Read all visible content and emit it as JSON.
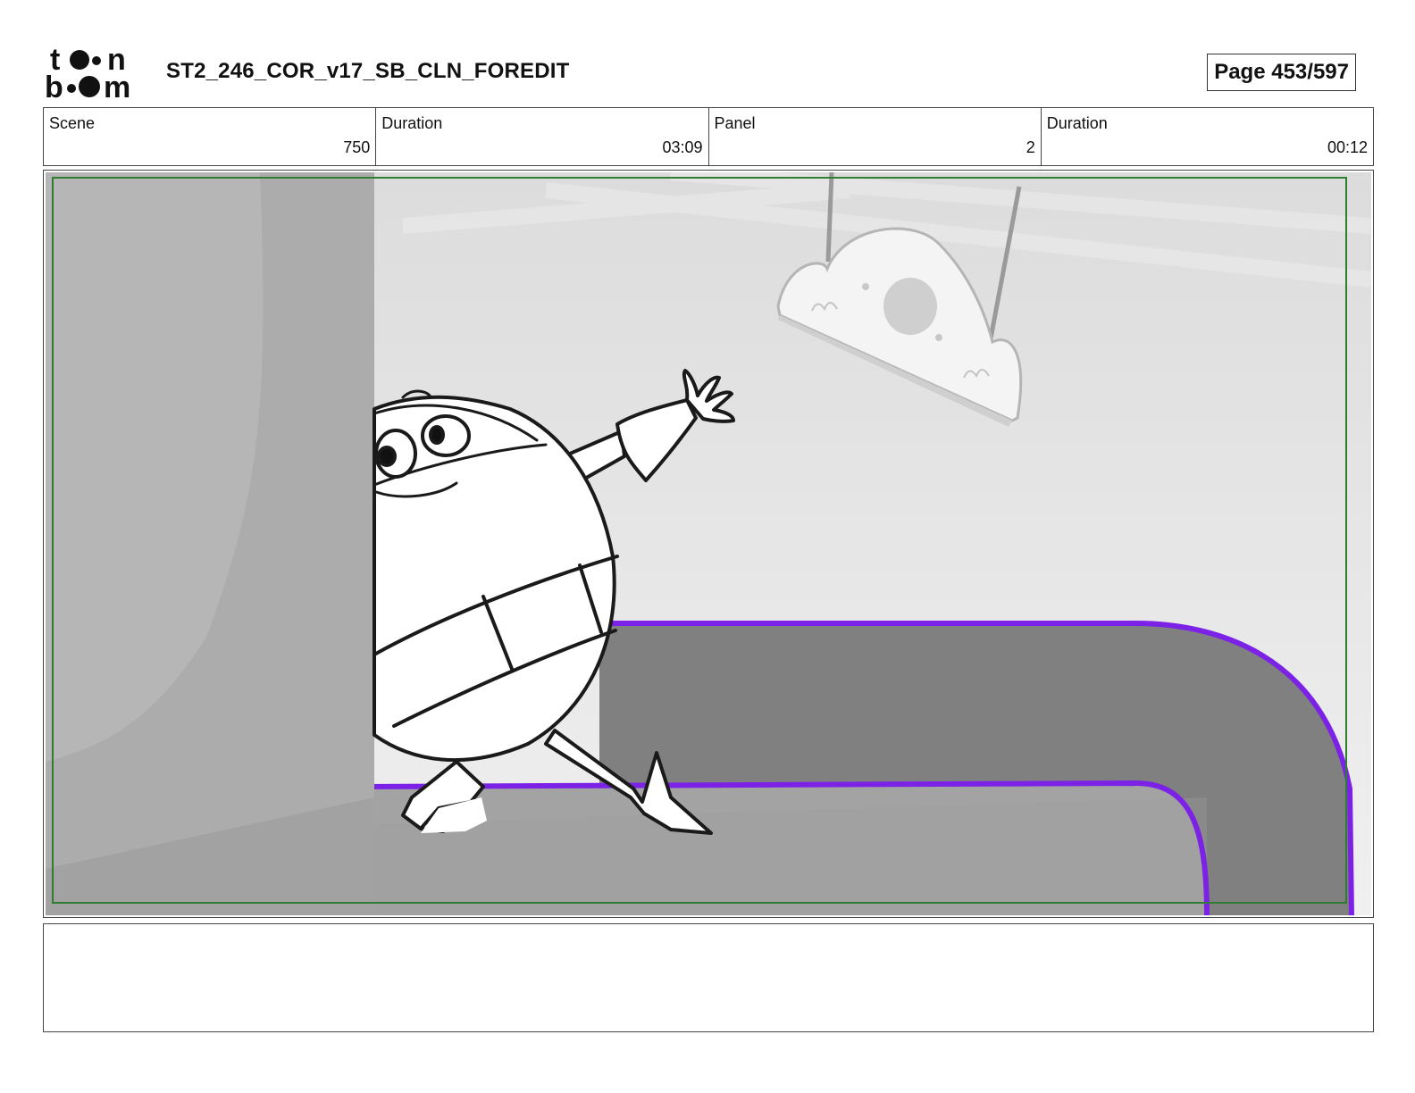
{
  "header": {
    "logo_text": "toonboom",
    "title": "ST2_246_COR_v17_SB_CLN_FOREDIT",
    "page": "Page 453/597"
  },
  "info": {
    "scene_label": "Scene",
    "scene_value": "750",
    "scene_duration_label": "Duration",
    "scene_duration_value": "03:09",
    "panel_label": "Panel",
    "panel_value": "2",
    "panel_duration_label": "Duration",
    "panel_duration_value": "00:12"
  },
  "panel_image": {
    "safe_frame_color": "#2e7d32",
    "path_outline_color": "#7b22e6"
  },
  "notes": {
    "text": ""
  }
}
